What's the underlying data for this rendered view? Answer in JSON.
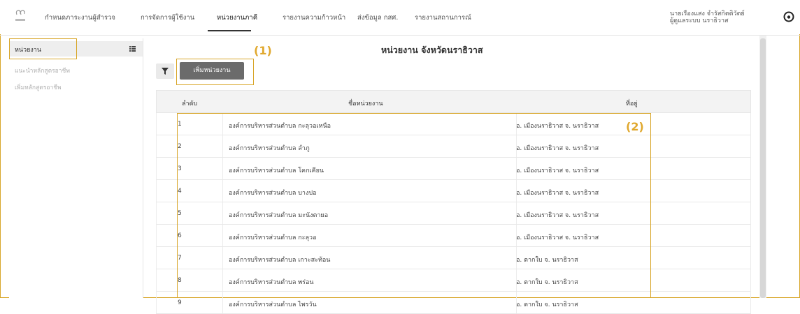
{
  "nav": {
    "items": [
      {
        "label": "กำหนดภาระงานผู้สำรวจ"
      },
      {
        "label": "การจัดการผู้ใช้งาน"
      },
      {
        "label": "หน่วยงานภาคี"
      },
      {
        "label": "รายงานความก้าวหน้า"
      },
      {
        "label": "ส่งข้อมูล กสศ."
      },
      {
        "label": "รายงานสถานการณ์"
      }
    ],
    "active_index": 2
  },
  "user": {
    "name": "นายเรืองแสง จำรัสกิตติวัตย์",
    "role": "ผู้ดูแลระบบ นราธิวาส"
  },
  "sidebar": {
    "header": "หน่วยงาน",
    "links": [
      {
        "label": "แนะนำหลักสูตรอาชีพ"
      },
      {
        "label": "เพิ่มหลักสูตรอาชีพ"
      }
    ]
  },
  "main": {
    "title": "หน่วยงาน จังหวัดนราธิวาส",
    "add_button": "เพิ่มหน่วยงาน",
    "annotations": [
      "(1)",
      "(2)"
    ],
    "columns": [
      "ลำดับ",
      "ชื่อหน่วยงาน",
      "ที่อยู่"
    ],
    "rows": [
      {
        "no": "1",
        "name": "องค์การบริหารส่วนตำบล กะลุวอเหนือ",
        "address": "อ. เมืองนราธิวาส จ. นราธิวาส"
      },
      {
        "no": "2",
        "name": "องค์การบริหารส่วนตำบล ลำภู",
        "address": "อ. เมืองนราธิวาส จ. นราธิวาส"
      },
      {
        "no": "3",
        "name": "องค์การบริหารส่วนตำบล โคกเคียน",
        "address": "อ. เมืองนราธิวาส จ. นราธิวาส"
      },
      {
        "no": "4",
        "name": "องค์การบริหารส่วนตำบล บางปอ",
        "address": "อ. เมืองนราธิวาส จ. นราธิวาส"
      },
      {
        "no": "5",
        "name": "องค์การบริหารส่วนตำบล มะนังตายอ",
        "address": "อ. เมืองนราธิวาส จ. นราธิวาส"
      },
      {
        "no": "6",
        "name": "องค์การบริหารส่วนตำบล กะลุวอ",
        "address": "อ. เมืองนราธิวาส จ. นราธิวาส"
      },
      {
        "no": "7",
        "name": "องค์การบริหารส่วนตำบล เกาะสะท้อน",
        "address": "อ. ตากใบ จ. นราธิวาส"
      },
      {
        "no": "8",
        "name": "องค์การบริหารส่วนตำบล พร่อน",
        "address": "อ. ตากใบ จ. นราธิวาส"
      },
      {
        "no": "9",
        "name": "องค์การบริหารส่วนตำบล ไพรวัน",
        "address": "อ. ตากใบ จ. นราธิวาส"
      }
    ]
  },
  "colors": {
    "accent": "#d8a629",
    "button": "#6b6b6b"
  }
}
